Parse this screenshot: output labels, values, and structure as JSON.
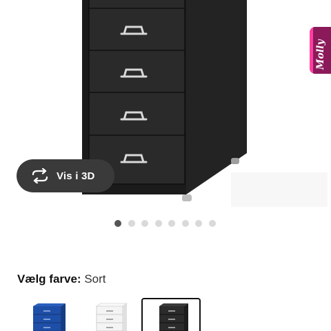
{
  "product": {
    "image_alt": "Black metal drawer unit with casters",
    "gallery": {
      "total": 8,
      "active_index": 0
    }
  },
  "view_3d": {
    "label": "Vis i 3D",
    "icon": "rotate-arrows-icon"
  },
  "chat_tab": {
    "label": "Molly",
    "color": "#8b1a5a"
  },
  "color_selector": {
    "heading": "Vælg farve:",
    "selected_value": "Sort",
    "options": [
      {
        "name": "Blå",
        "color": "#1e4fa8",
        "selected": false
      },
      {
        "name": "Hvid",
        "color": "#f2f2f2",
        "selected": false
      },
      {
        "name": "Sort",
        "color": "#2b2b2b",
        "selected": true
      }
    ]
  }
}
